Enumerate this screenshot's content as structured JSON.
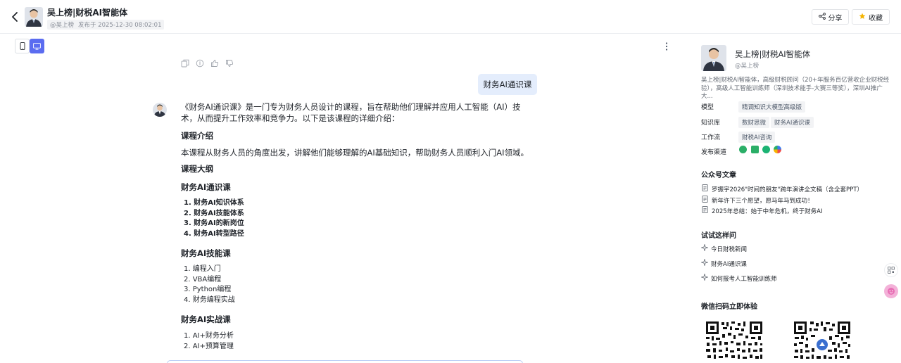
{
  "header": {
    "title": "吴上榜|财税AI智能体",
    "author": "@吴上榜",
    "published": "发布于 2025-12-30 08:02:01",
    "share_label": "分享",
    "favorite_label": "收藏"
  },
  "chat": {
    "user_message": "财务AI通识课",
    "reply": {
      "intro": "《财务AI通识课》是一门专为财务人员设计的课程，旨在帮助他们理解并应用人工智能（AI）技术，从而提升工作效率和竞争力。以下是该课程的详细介绍：",
      "section_intro_heading": "课程介绍",
      "section_intro_text": "本课程从财务人员的角度出发，讲解他们能够理解的AI基础知识，帮助财务人员顺利入门AI领域。",
      "outline_heading": "课程大纲",
      "course1_heading": "财务AI通识课",
      "course1_items": [
        "1. 财务AI知识体系",
        "2. 财务AI技能体系",
        "3. 财务AI的新岗位",
        "4. 财务AI转型路径"
      ],
      "course2_heading": "财务AI技能课",
      "course2_items": [
        "1. 编程入门",
        "2. VBA编程",
        "3. Python编程",
        "4. 财务编程实战"
      ],
      "course3_heading": "财务AI实战课",
      "course3_items": [
        "1. AI+财务分析",
        "2. AI+预算管理"
      ]
    }
  },
  "profile": {
    "name": "吴上榜|财税AI智能体",
    "author": "@吴上榜",
    "description": "吴上榜|财税AI智能体，高级财税顾问（20+年服务百亿营收企业财税经验），高级人工智能训练师（深圳技术能手-大赛三等奖），深圳AI推广大...",
    "model_label": "模型",
    "model_value": "精调知识大模型高级版",
    "kb_label": "知识库",
    "kb_values": [
      "数财思微",
      "财务AI通识课"
    ],
    "workflow_label": "工作流",
    "workflow_value": "财税AI咨询",
    "channels_label": "发布渠道",
    "channels": [
      {
        "icon": "wechat-icon",
        "color": "#2aae67"
      },
      {
        "icon": "wechat-official-icon",
        "color": "#2aae67"
      },
      {
        "icon": "mini-program-icon",
        "color": "#1bb373"
      },
      {
        "icon": "app-icon",
        "color": "#3a7cf0"
      }
    ],
    "articles_heading": "公众号文章",
    "articles": [
      "罗振宇2026\"时间的朋友\"跨年演讲全文稿（含全套PPT）",
      "新年许下三个愿望，愿马年马到成功！",
      "2025年总结：始于中年危机，终于财务AI"
    ],
    "try_heading": "试试这样问",
    "try_questions": [
      "今日财税新闻",
      "财务AI通识课",
      "如何报考人工智能训练师"
    ],
    "qr_heading": "微信扫码立即体验"
  }
}
